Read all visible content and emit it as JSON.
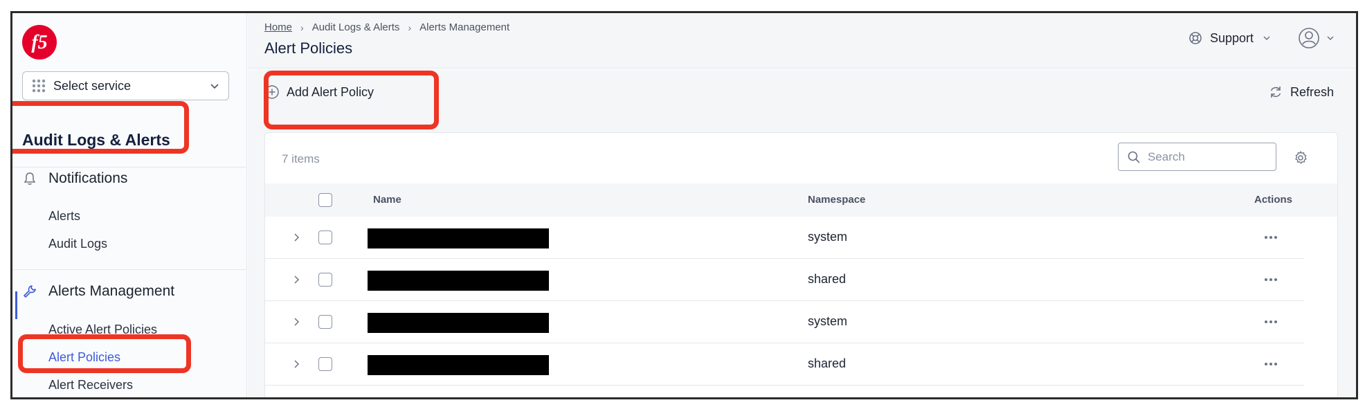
{
  "sidebar": {
    "select_service": "Select service",
    "section_title": "Audit Logs & Alerts",
    "groups": [
      {
        "label": "Notifications",
        "icon": "bell-icon",
        "items": [
          "Alerts",
          "Audit Logs"
        ]
      },
      {
        "label": "Alerts Management",
        "icon": "wrench-icon",
        "items": [
          "Active Alert Policies",
          "Alert Policies",
          "Alert Receivers"
        ]
      }
    ],
    "active_item": "Alert Policies"
  },
  "header": {
    "breadcrumb": [
      "Home",
      "Audit Logs & Alerts",
      "Alerts Management"
    ],
    "title": "Alert Policies",
    "support_label": "Support"
  },
  "toolbar": {
    "add_label": "Add Alert Policy",
    "refresh_label": "Refresh"
  },
  "table": {
    "count": "7 items",
    "search_placeholder": "Search",
    "columns": [
      "Name",
      "Namespace",
      "Actions"
    ],
    "rows": [
      {
        "name": "",
        "namespace": "system"
      },
      {
        "name": "",
        "namespace": "shared"
      },
      {
        "name": "",
        "namespace": "system"
      },
      {
        "name": "",
        "namespace": "shared"
      }
    ]
  },
  "colors": {
    "accent": "#3d5bd9",
    "highlight": "#ee3524",
    "brand_logo": "#e4002b"
  }
}
